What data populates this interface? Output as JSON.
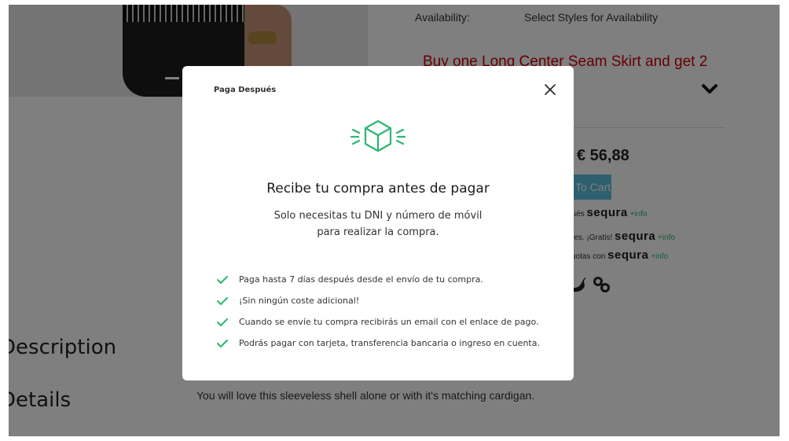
{
  "product": {
    "availability_label": "Availability:",
    "availability_value": "Select Styles for Availability",
    "promo": "Buy one Long Center Seam Skirt and get 2",
    "price": "€ 56,88",
    "cart_label": "To Cart",
    "sequra_rows": [
      {
        "text": "pués",
        "brand": "sequra",
        "info": "+info"
      },
      {
        "text": "mes. ¡Gratis!",
        "brand": "sequra",
        "info": "+info"
      },
      {
        "text": "cuotas con",
        "brand": "sequra",
        "info": "+info"
      }
    ],
    "sections": {
      "description": "Description",
      "details": "Details",
      "details_text": "You will love this sleeveless shell alone or with it's matching cardigan."
    }
  },
  "modal": {
    "title": "Paga Después",
    "heading": "Recibe tu compra antes de pagar",
    "subtitle_line1": "Solo necesitas tu DNI y número de móvil",
    "subtitle_line2": "para realizar la compra.",
    "features": [
      "Paga hasta 7 días después desde el envío de tu compra.",
      "¡Sin ningún coste adicional!",
      "Cuando se envíe tu compra recibirás un email con el enlace de pago.",
      "Podrás pagar con tarjeta, transferencia bancaria o ingreso en cuenta."
    ],
    "icons": {
      "close": "close-icon",
      "box": "box-icon",
      "check": "check-icon"
    }
  },
  "colors": {
    "accent_green": "#2bb673",
    "promo_red": "#cc0000",
    "cart_blue": "#5bc0de",
    "overlay": "rgba(0,0,0,0.5)"
  }
}
